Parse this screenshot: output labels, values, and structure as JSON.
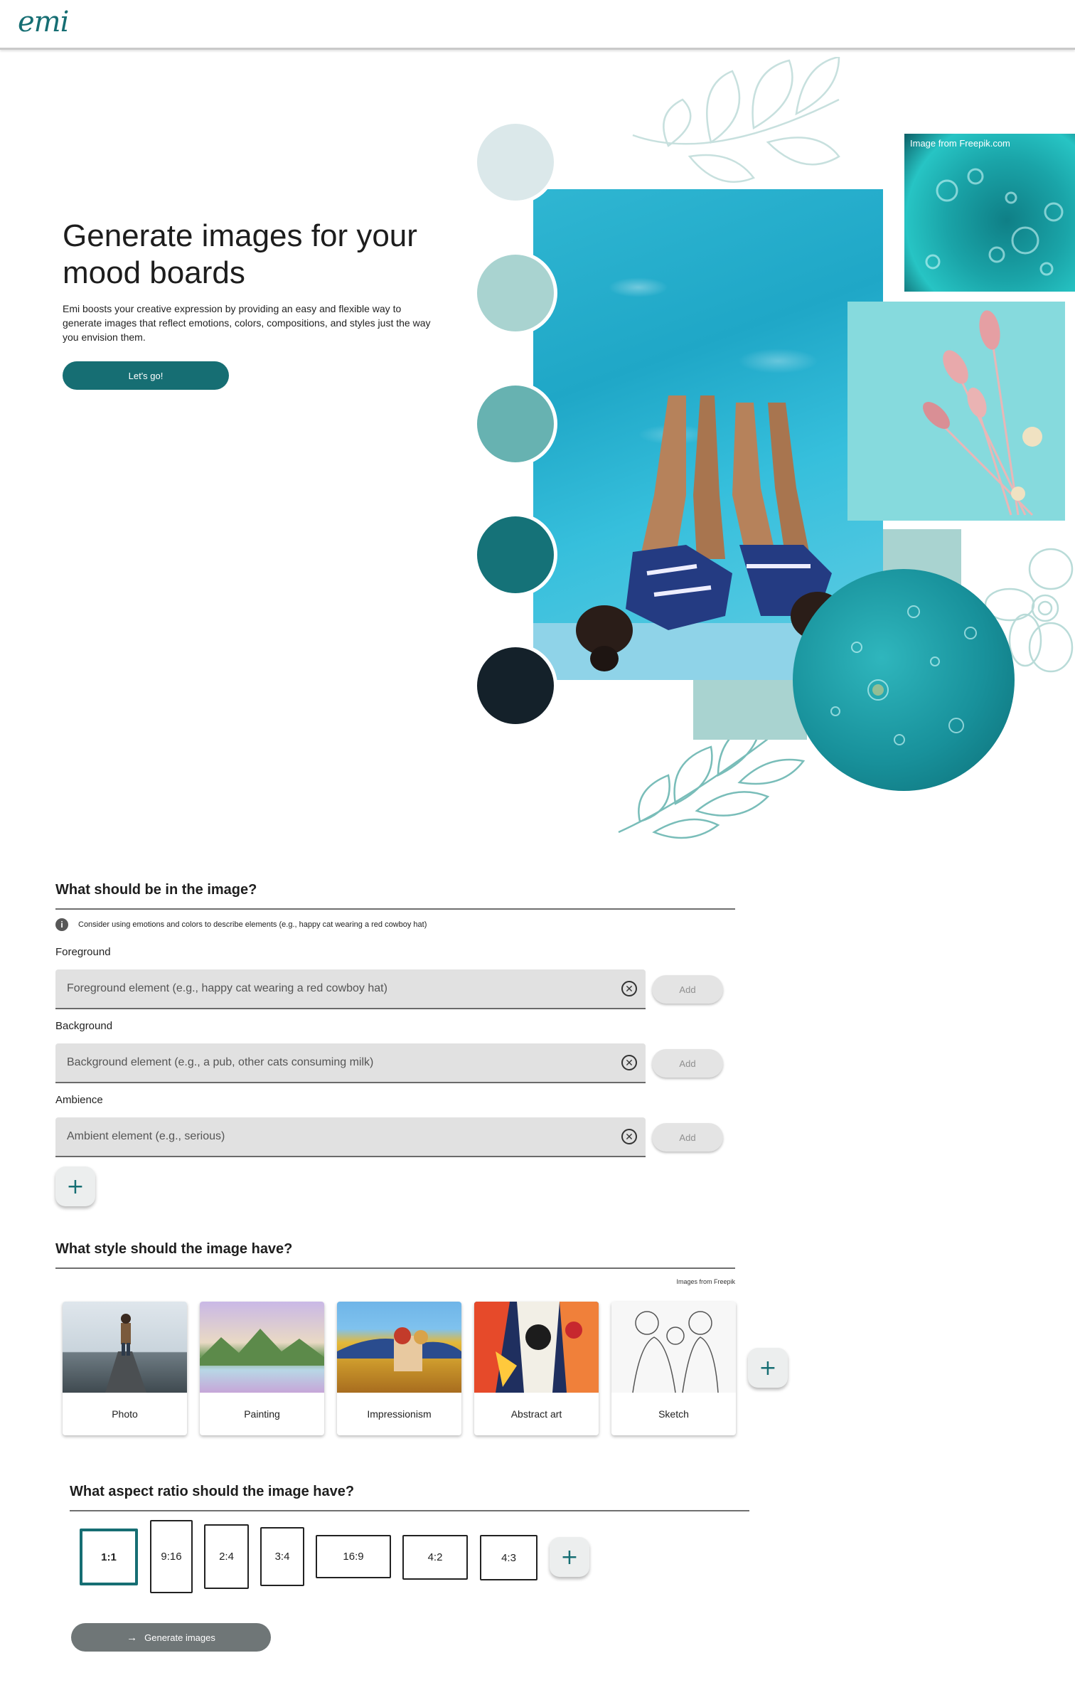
{
  "header": {
    "logo": "emi"
  },
  "hero": {
    "title": "Generate images for your mood boards",
    "description": "Emi boosts your creative expression by providing an easy and flexible way to generate images that reflect emotions, colors, compositions, and styles just the way you envision them.",
    "cta_label": "Let's go!",
    "image_credit": "Image from Freepik.com",
    "palette": [
      "#dbe8ea",
      "#a9d3d0",
      "#67b2b1",
      "#157278",
      "#14212a"
    ]
  },
  "content_section": {
    "title": "What should be in the image?",
    "hint": "Consider using emotions and colors to describe elements (e.g., happy cat wearing a red cowboy hat)",
    "fields": [
      {
        "label": "Foreground",
        "placeholder": "Foreground element (e.g., happy cat wearing a red cowboy hat)",
        "value": "",
        "add_label": "Add"
      },
      {
        "label": "Background",
        "placeholder": "Background element (e.g., a pub, other cats consuming milk)",
        "value": "",
        "add_label": "Add"
      },
      {
        "label": "Ambience",
        "placeholder": "Ambient element (e.g., serious)",
        "value": "",
        "add_label": "Add"
      }
    ],
    "add_field_symbol": "+"
  },
  "style_section": {
    "title": "What style should the image have?",
    "credit": "Images from Freepik",
    "styles": [
      {
        "label": "Photo"
      },
      {
        "label": "Painting"
      },
      {
        "label": "Impressionism"
      },
      {
        "label": "Abstract art"
      },
      {
        "label": "Sketch"
      }
    ],
    "add_style_symbol": "+"
  },
  "aspect_section": {
    "title": "What aspect ratio should the image have?",
    "ratios": [
      {
        "label": "1:1",
        "selected": true
      },
      {
        "label": "9:16",
        "selected": false
      },
      {
        "label": "2:4",
        "selected": false
      },
      {
        "label": "3:4",
        "selected": false
      },
      {
        "label": "16:9",
        "selected": false
      },
      {
        "label": "4:2",
        "selected": false
      },
      {
        "label": "4:3",
        "selected": false
      }
    ],
    "add_ratio_symbol": "+"
  },
  "generate": {
    "label": "Generate images",
    "icon": "arrow-right-icon"
  },
  "colors": {
    "brand": "#166e73",
    "input_bg": "#e1e1e1",
    "disabled_button": "#6f7677"
  }
}
